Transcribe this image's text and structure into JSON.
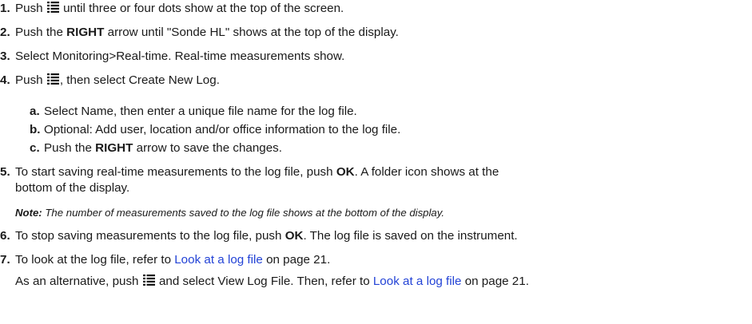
{
  "icons": {
    "menu": "menu-icon"
  },
  "steps": [
    {
      "num": "1.",
      "a": "Push ",
      "b": " until three or four dots show at the top of the screen."
    },
    {
      "num": "2.",
      "a": "Push the ",
      "bold": "RIGHT",
      "b": " arrow until \"Sonde HL\" shows at the top of the display."
    },
    {
      "num": "3.",
      "text": "Select Monitoring>Real-time. Real-time measurements show."
    },
    {
      "num": "4.",
      "a": "Push ",
      "b": ", then select Create New Log."
    },
    {
      "num": "5.",
      "a": "To start saving real-time measurements to the log file, push ",
      "bold": "OK",
      "b": ". A folder icon shows at the",
      "cont": "bottom of the display."
    },
    {
      "num": "6.",
      "a": "To stop saving measurements to the log file, push ",
      "bold": "OK",
      "b": ". The log file is saved on the instrument."
    },
    {
      "num": "7.",
      "a": "To look at the log file, refer to ",
      "link": "Look at a log file",
      "b": " on page 21."
    }
  ],
  "substeps": [
    {
      "num": "a.",
      "text": "Select Name, then enter a unique file name for the log file."
    },
    {
      "num": "b.",
      "text": "Optional: Add user, location and/or office information to the log file."
    },
    {
      "num": "c.",
      "a": "Push the ",
      "bold": "RIGHT",
      "b": " arrow to save the changes."
    }
  ],
  "note": {
    "label": "Note:",
    "text": " The number of measurements saved to the log file shows at the bottom of the display."
  },
  "alternative": {
    "a": "As an alternative, push ",
    "b": " and select View Log File. Then, refer to ",
    "link": "Look at a log file",
    "c": " on page 21."
  }
}
